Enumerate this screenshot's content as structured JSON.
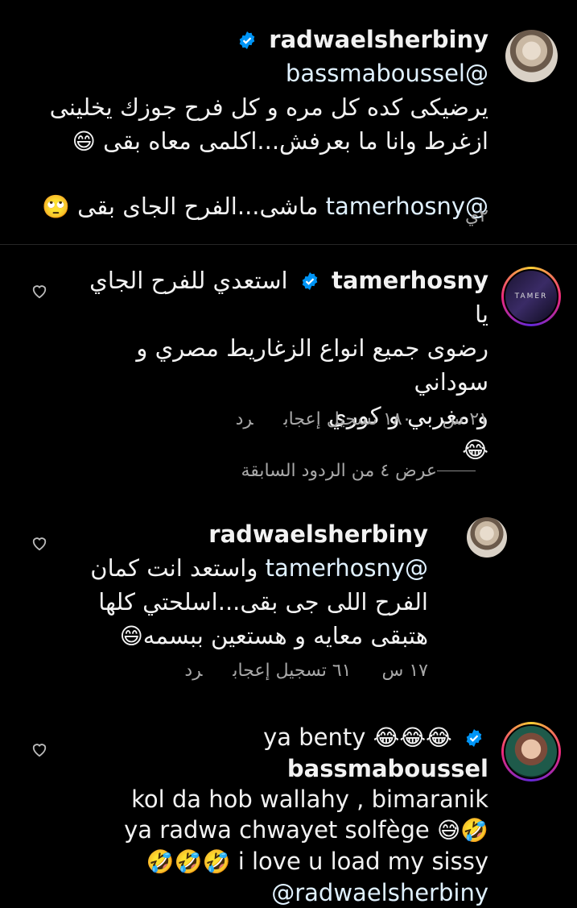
{
  "comment1": {
    "username": "radwaelsherbiny",
    "mention": "bassmaboussel@",
    "line1": "يرضيكى كده كل مره و كل فرح جوزك يخلينى",
    "line2": "ازغرط وانا ما بعرفش...اكلمى معاه بقى",
    "line2_emoji": "😄",
    "line3_mention": "tamerhosny@",
    "line3_text": "ماشى...الفرح الجاى بقى",
    "line3_emoji": "🙄",
    "time": "٢ي"
  },
  "comment2": {
    "username": "tamerhosny",
    "avatar_text": "TAMER",
    "line1": "استعدي للفرح الجاي يا",
    "line2": "رضوى جميع انواع الزغاريط مصري و سوداني",
    "line3": "و مغربي و كوري",
    "line4_emoji": "😂",
    "time": "٢١ س",
    "likes": "١٨٠ تسجيل إعجاب",
    "reply": "رد"
  },
  "view_replies": "عرض ٤ من الردود السابقة",
  "comment3": {
    "username": "radwaelsherbiny",
    "mention": "tamerhosny@",
    "line1": "واستعد انت كمان",
    "line2": "الفرح اللى جى بقى...اسلحتي كلها",
    "line3": "هتبقى معايه و هستعين ببسمه",
    "line3_emoji": "😄",
    "time": "١٧ س",
    "likes": "٦١ تسجيل إعجاب",
    "reply": "رد"
  },
  "comment4": {
    "username": "bassmaboussel",
    "line1_text": "ya benty",
    "line1_emoji": "😂😂😂",
    "line2": "kol da hob wallahy , bimaranik",
    "line3_text": "ya radwa chwayet solfège",
    "line3_emoji": "😅🤣",
    "line4_emoji": "🤣🤣🤣",
    "line4_text": "i love u load my sissy",
    "line5": "@radwaelsherbiny"
  },
  "colors": {
    "background": "#000000",
    "text": "#f5f5f5",
    "secondary": "#a8a8a8",
    "verified": "#0095f6"
  }
}
